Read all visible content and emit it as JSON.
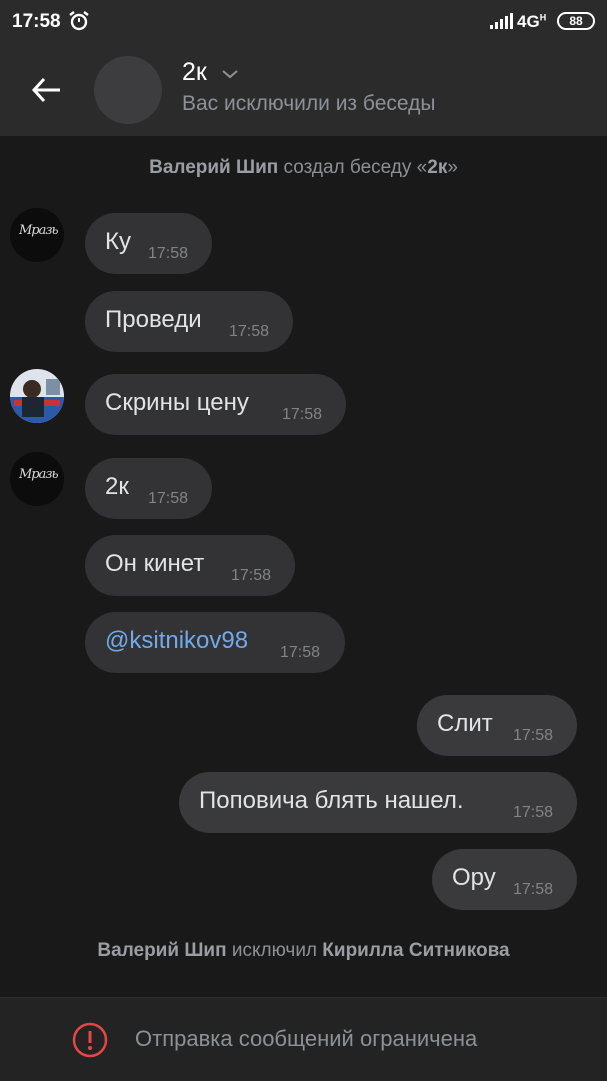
{
  "status_bar": {
    "time": "17:58",
    "network": "4G",
    "network_sub": "H",
    "battery": "88"
  },
  "header": {
    "title": "2к",
    "subtitle": "Вас исключили из беседы"
  },
  "service_created": {
    "actor": "Валерий Шип",
    "action": " создал беседу «",
    "name": "2к",
    "end": "»"
  },
  "messages": [
    {
      "text": "Ку",
      "time": "17:58"
    },
    {
      "text": "Проведи",
      "time": "17:58"
    },
    {
      "text": "Скрины цену",
      "time": "17:58"
    },
    {
      "text": "2к",
      "time": "17:58"
    },
    {
      "text": "Он кинет",
      "time": "17:58"
    },
    {
      "text": "@ksitnikov98",
      "time": "17:58"
    },
    {
      "text": "Слит",
      "time": "17:58"
    },
    {
      "text": "Поповича блять нашел.",
      "time": "17:58"
    },
    {
      "text": "Ору",
      "time": "17:58"
    }
  ],
  "avatars": {
    "dark_label": "Мразь"
  },
  "service_excluded": {
    "actor": "Валерий Шип",
    "action": " исключил ",
    "target": "Кирилла Ситникова"
  },
  "footer": {
    "text": "Отправка сообщений ограничена"
  },
  "colors": {
    "background": "#19191a",
    "bubble": "#333335",
    "link": "#71aaeb",
    "warning": "#e64646"
  }
}
